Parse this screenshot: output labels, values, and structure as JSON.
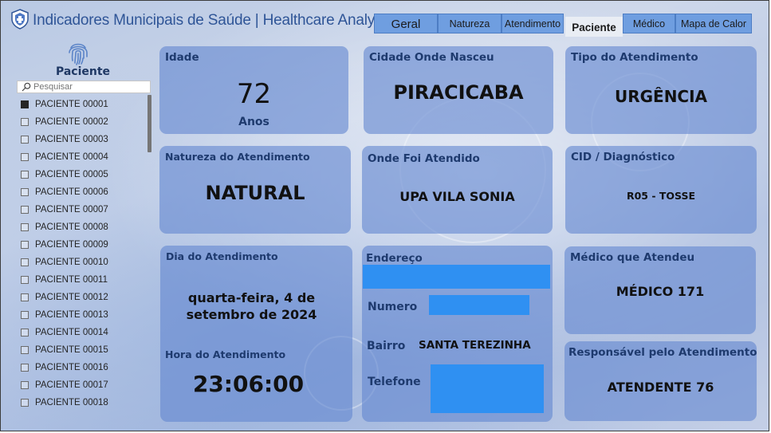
{
  "header": {
    "title": "Indicadores Municipais de Saúde | Healthcare Analytics",
    "tabs": [
      {
        "label": "Geral"
      },
      {
        "label": "Natureza"
      },
      {
        "label": "Atendimento"
      },
      {
        "label": "Paciente",
        "active": true
      },
      {
        "label": "Médico"
      },
      {
        "label": "Mapa de Calor"
      }
    ]
  },
  "sidebar": {
    "title": "Paciente",
    "search_placeholder": "Pesquisar",
    "icons": {
      "top": "fingerprint-icon",
      "search": "search-icon"
    },
    "items": [
      {
        "label": "PACIENTE 00001",
        "checked": true
      },
      {
        "label": "PACIENTE 00002"
      },
      {
        "label": "PACIENTE 00003"
      },
      {
        "label": "PACIENTE 00004"
      },
      {
        "label": "PACIENTE 00005"
      },
      {
        "label": "PACIENTE 00006"
      },
      {
        "label": "PACIENTE 00007"
      },
      {
        "label": "PACIENTE 00008"
      },
      {
        "label": "PACIENTE 00009"
      },
      {
        "label": "PACIENTE 00010"
      },
      {
        "label": "PACIENTE 00011"
      },
      {
        "label": "PACIENTE 00012"
      },
      {
        "label": "PACIENTE 00013"
      },
      {
        "label": "PACIENTE 00014"
      },
      {
        "label": "PACIENTE 00015"
      },
      {
        "label": "PACIENTE 00016"
      },
      {
        "label": "PACIENTE 00017"
      },
      {
        "label": "PACIENTE 00018"
      }
    ]
  },
  "cards": {
    "idade": {
      "label": "Idade",
      "value": "72",
      "unit": "Anos"
    },
    "cidade": {
      "label": "Cidade Onde Nasceu",
      "value": "PIRACICABA"
    },
    "tipo": {
      "label": "Tipo do Atendimento",
      "value": "URGÊNCIA"
    },
    "natureza": {
      "label": "Natureza do Atendimento",
      "value": "NATURAL"
    },
    "onde": {
      "label": "Onde Foi Atendido",
      "value": "UPA VILA SONIA"
    },
    "cid": {
      "label": "CID / Diagnóstico",
      "value": "R05 - TOSSE"
    },
    "dia": {
      "label": "Dia do Atendimento",
      "value_line1": "quarta-feira, 4 de",
      "value_line2": "setembro de 2024"
    },
    "hora": {
      "label": "Hora do Atendimento",
      "value": "23:06:00"
    },
    "endereco": {
      "label": "Endereço",
      "numero_label": "Numero",
      "bairro_label": "Bairro",
      "bairro_value": "SANTA TEREZINHA",
      "telefone_label": "Telefone"
    },
    "medico": {
      "label": "Médico que Atendeu",
      "value": "MÉDICO 171"
    },
    "responsavel": {
      "label": "Responsável pelo Atendimento",
      "value": "ATENDENTE 76"
    }
  },
  "colors": {
    "accent": "#2f5597",
    "tab_bg": "#6f9ee0",
    "card_bg": "#6488d0",
    "redaction": "#2f90f2"
  }
}
